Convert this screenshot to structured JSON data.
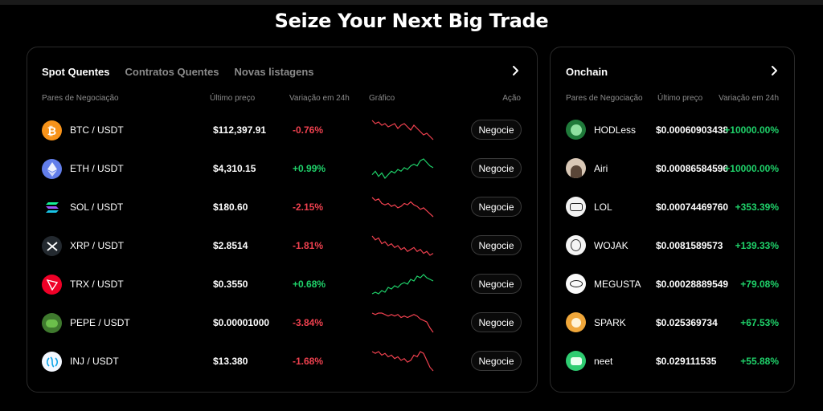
{
  "headline": "Seize Your Next Big Trade",
  "colors": {
    "up": "#1fd26a",
    "down": "#f0414f",
    "background": "#000000",
    "muted": "#8b8b8b"
  },
  "spot": {
    "tabs": [
      {
        "label": "Spot Quentes",
        "active": true
      },
      {
        "label": "Contratos Quentes",
        "active": false
      },
      {
        "label": "Novas listagens",
        "active": false
      }
    ],
    "more_icon": "chevron-right-icon",
    "columns": {
      "pair": "Pares de Negociação",
      "price": "Último preço",
      "change": "Variação em 24h",
      "chart": "Gráfico",
      "action": "Ação"
    },
    "rows": [
      {
        "icon": "btc-icon",
        "pair": "BTC / USDT",
        "price": "$112,397.91",
        "change": "-0.76%",
        "trend": "down",
        "button": "Negocie",
        "sparkline": [
          6,
          8,
          7,
          9,
          8,
          10,
          9,
          8,
          11,
          9,
          8,
          10,
          12,
          9,
          11,
          13,
          15,
          14,
          16,
          18
        ]
      },
      {
        "icon": "eth-icon",
        "pair": "ETH / USDT",
        "price": "$4,310.15",
        "change": "+0.99%",
        "trend": "up",
        "button": "Negocie",
        "sparkline": [
          14,
          12,
          15,
          13,
          16,
          14,
          12,
          13,
          11,
          12,
          10,
          11,
          9,
          8,
          9,
          6,
          5,
          7,
          9,
          10
        ]
      },
      {
        "icon": "sol-icon",
        "pair": "SOL / USDT",
        "price": "$180.60",
        "change": "-2.15%",
        "trend": "down",
        "button": "Negocie",
        "sparkline": [
          4,
          6,
          5,
          8,
          9,
          8,
          10,
          9,
          11,
          10,
          8,
          9,
          7,
          9,
          10,
          12,
          11,
          13,
          15,
          17
        ]
      },
      {
        "icon": "xrp-icon",
        "pair": "XRP / USDT",
        "price": "$2.8514",
        "change": "-1.81%",
        "trend": "down",
        "button": "Negocie",
        "sparkline": [
          5,
          7,
          6,
          9,
          8,
          10,
          9,
          11,
          10,
          12,
          11,
          13,
          12,
          11,
          13,
          12,
          14,
          13,
          15,
          14
        ]
      },
      {
        "icon": "trx-icon",
        "pair": "TRX / USDT",
        "price": "$0.3550",
        "change": "+0.68%",
        "trend": "up",
        "button": "Negocie",
        "sparkline": [
          16,
          15,
          16,
          14,
          15,
          12,
          13,
          11,
          12,
          10,
          9,
          10,
          7,
          8,
          5,
          6,
          4,
          6,
          7,
          8
        ]
      },
      {
        "icon": "pepe-icon",
        "pair": "PEPE / USDT",
        "price": "$0.00001000",
        "change": "-3.84%",
        "trend": "down",
        "button": "Negocie",
        "sparkline": [
          5,
          6,
          5,
          5,
          6,
          7,
          6,
          7,
          6,
          8,
          7,
          8,
          7,
          6,
          7,
          9,
          10,
          11,
          15,
          18
        ]
      },
      {
        "icon": "inj-icon",
        "pair": "INJ / USDT",
        "price": "$13.380",
        "change": "-1.68%",
        "trend": "down",
        "button": "Negocie",
        "sparkline": [
          7,
          8,
          7,
          9,
          8,
          10,
          9,
          11,
          10,
          12,
          11,
          13,
          12,
          9,
          10,
          7,
          8,
          12,
          16,
          18
        ]
      }
    ]
  },
  "onchain": {
    "title": "Onchain",
    "more_icon": "chevron-right-icon",
    "columns": {
      "pair": "Pares de Negociação",
      "price": "Último preço",
      "change": "Variação em 24h"
    },
    "rows": [
      {
        "icon": "hodless-icon",
        "name": "HODLess",
        "price": "$0.00060903438",
        "change": "+10000.00%",
        "trend": "up"
      },
      {
        "icon": "airi-icon",
        "name": "Airi",
        "price": "$0.00086584596",
        "change": "+10000.00%",
        "trend": "up"
      },
      {
        "icon": "lol-icon",
        "name": "LOL",
        "price": "$0.00074469760",
        "change": "+353.39%",
        "trend": "up"
      },
      {
        "icon": "wojak-icon",
        "name": "WOJAK",
        "price": "$0.0081589573",
        "change": "+139.33%",
        "trend": "up"
      },
      {
        "icon": "megusta-icon",
        "name": "MEGUSTA",
        "price": "$0.00028889549",
        "change": "+79.08%",
        "trend": "up"
      },
      {
        "icon": "spark-icon",
        "name": "SPARK",
        "price": "$0.025369734",
        "change": "+67.53%",
        "trend": "up"
      },
      {
        "icon": "neet-icon",
        "name": "neet",
        "price": "$0.029111535",
        "change": "+55.88%",
        "trend": "up"
      }
    ]
  }
}
